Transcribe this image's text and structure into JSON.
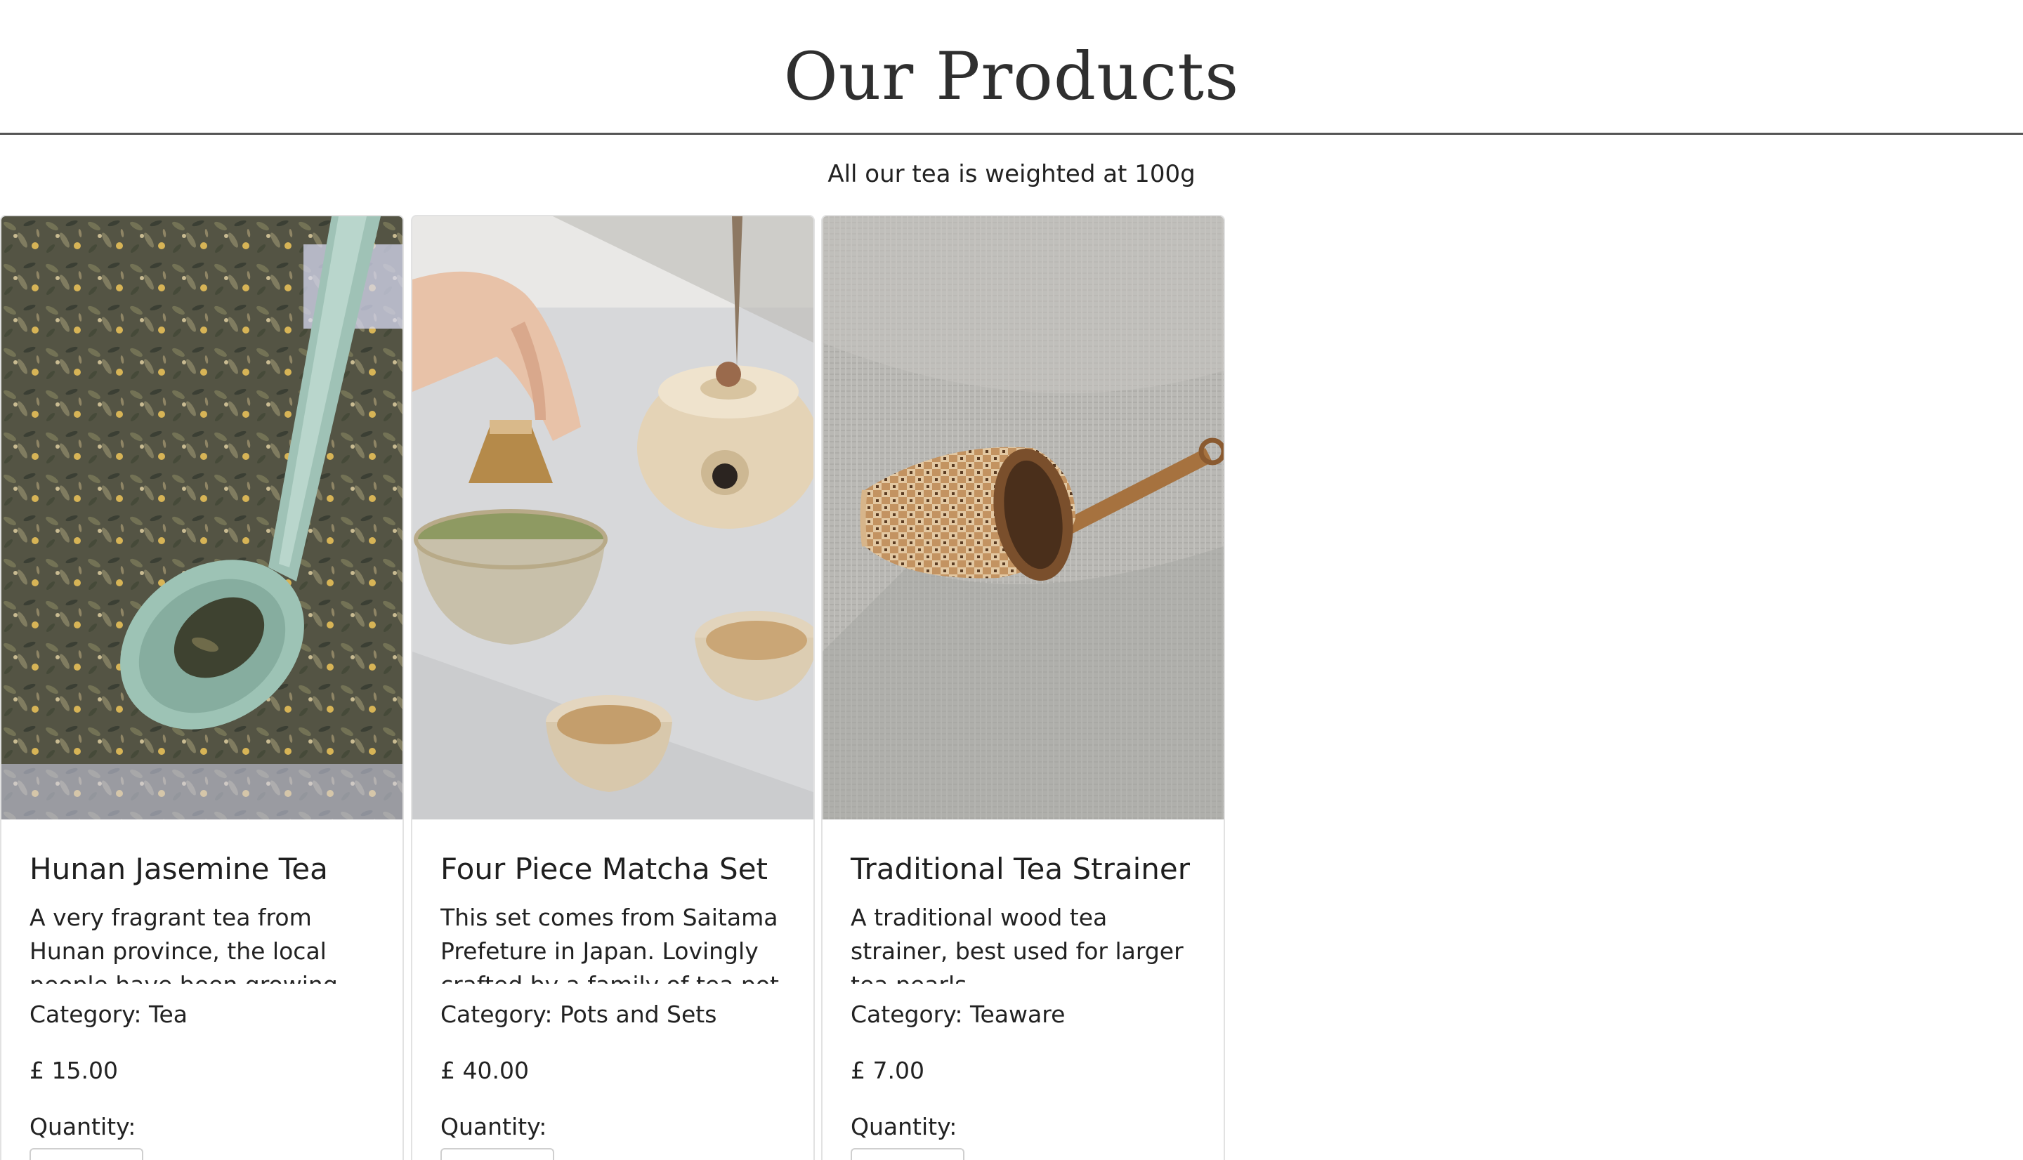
{
  "header": {
    "title": "Our Products"
  },
  "subtitle": "All our tea is weighted at 100g",
  "products": [
    {
      "title": "Hunan Jasemine Tea",
      "description": "A very fragrant tea from Hunan province, the local people have been growing",
      "category": "Category: Tea",
      "price": "£ 15.00",
      "quantity_label": "Quantity:",
      "image_icon": "loose-leaf-tea-with-spoon"
    },
    {
      "title": "Four Piece Matcha Set",
      "description": "This set comes from Saitama Prefeture in Japan. Lovingly crafted by a family of tea pot",
      "category": "Category: Pots and Sets",
      "price": "£ 40.00",
      "quantity_label": "Quantity:",
      "image_icon": "matcha-set-with-teapot"
    },
    {
      "title": "Traditional Tea Strainer",
      "description": "A traditional wood tea strainer, best used for larger tea pearls.",
      "category": "Category: Teaware",
      "price": "£ 7.00",
      "quantity_label": "Quantity:",
      "image_icon": "bamboo-tea-strainer"
    }
  ],
  "colors": {
    "text": "#212529",
    "header_rule": "#555555",
    "card_border": "#e2e2e2"
  }
}
